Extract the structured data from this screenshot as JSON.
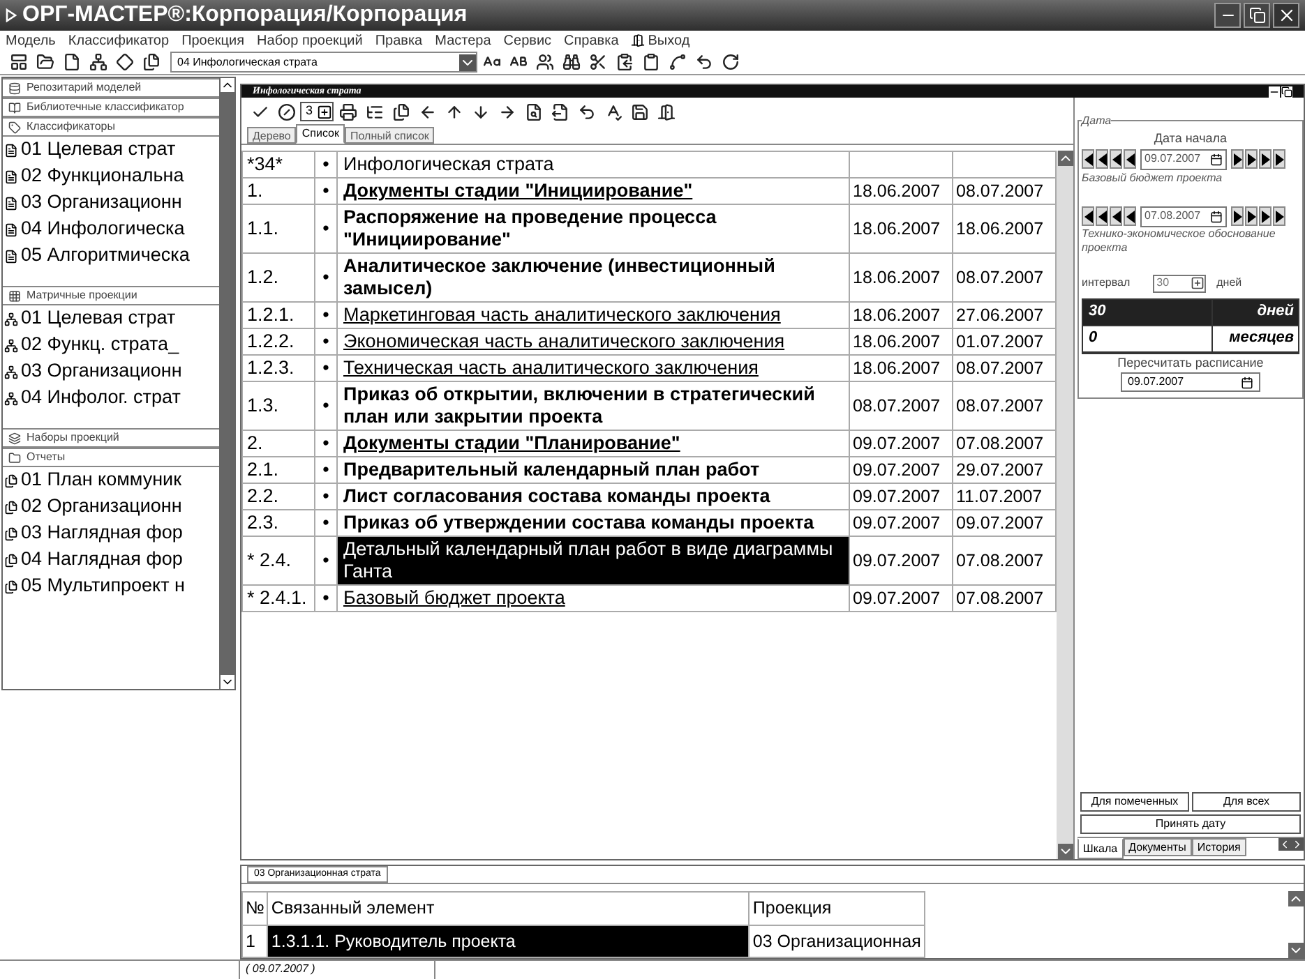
{
  "window": {
    "title": "ОРГ-МАСТЕР®:Корпорация/Корпорация"
  },
  "menu": [
    "Модель",
    "Классификатор",
    "Проекция",
    "Набор проекций",
    "Правка",
    "Мастера",
    "Сервис",
    "Справка",
    "Выход"
  ],
  "toolbar": {
    "projection": "04 Инфологическая страта"
  },
  "left_panel": {
    "sections": [
      {
        "title": "Репозитарий моделей",
        "kind": "repo"
      },
      {
        "title": "Библиотечные классификатор",
        "kind": "library"
      },
      {
        "title": "Классификаторы",
        "kind": "classifier",
        "items": [
          "01 Целевая страт",
          "02 Функциональна",
          "03 Организационн",
          "04 Инфологическа",
          "05 Алгоритмическа"
        ]
      },
      {
        "title": "Матричные проекции",
        "kind": "matrix",
        "items": [
          "01 Целевая страт",
          "02 Функц. страта_",
          "03 Организационн",
          "04 Инфолог. страт"
        ]
      },
      {
        "title": "Наборы проекций",
        "kind": "sets"
      },
      {
        "title": "Отчеты",
        "kind": "reports",
        "items": [
          "01 План коммуник",
          "02 Организационн",
          "03 Наглядная фор",
          "04 Наглядная фор",
          "05 Мультипроект н"
        ]
      }
    ]
  },
  "document": {
    "title": "Инфологическая страта",
    "level_value": "3",
    "tabs": [
      {
        "label": "Дерево",
        "selected": false
      },
      {
        "label": "Список",
        "selected": true
      },
      {
        "label": "Полный список",
        "selected": false
      }
    ],
    "header": {
      "number": "*34*",
      "bullet": "•",
      "name": "Инфологическая страта"
    },
    "rows": [
      {
        "number": "1.",
        "bullet": "•",
        "name": "Документы стадии \"Инициирование\"",
        "kind": "heading",
        "start": "18.06.2007",
        "end": "08.07.2007",
        "selected": false
      },
      {
        "number": "1.1.",
        "bullet": "•",
        "name": "Распоряжение на проведение процесса \"Инициирование\"",
        "kind": "bold",
        "start": "18.06.2007",
        "end": "18.06.2007",
        "selected": false
      },
      {
        "number": "1.2.",
        "bullet": "•",
        "name": "Аналитическое заключение (инвестиционный замысел)",
        "kind": "bold",
        "start": "18.06.2007",
        "end": "08.07.2007",
        "selected": false
      },
      {
        "number": "1.2.1.",
        "bullet": "•",
        "name": "Маркетинговая часть аналитического заключения",
        "kind": "link",
        "start": "18.06.2007",
        "end": "27.06.2007",
        "selected": false
      },
      {
        "number": "1.2.2.",
        "bullet": "•",
        "name": "Экономическая часть аналитического заключения",
        "kind": "link",
        "start": "18.06.2007",
        "end": "01.07.2007",
        "selected": false
      },
      {
        "number": "1.2.3.",
        "bullet": "•",
        "name": "Техническая часть аналитического заключения",
        "kind": "link",
        "start": "18.06.2007",
        "end": "08.07.2007",
        "selected": false
      },
      {
        "number": "1.3.",
        "bullet": "•",
        "name": "Приказ об открытии, включении в стратегический план или закрытии проекта",
        "kind": "bold",
        "start": "08.07.2007",
        "end": "08.07.2007",
        "selected": false
      },
      {
        "number": "2.",
        "bullet": "•",
        "name": "Документы стадии \"Планирование\"",
        "kind": "heading",
        "start": "09.07.2007",
        "end": "07.08.2007",
        "selected": false
      },
      {
        "number": "2.1.",
        "bullet": "•",
        "name": "Предварительный календарный план работ",
        "kind": "bold",
        "start": "09.07.2007",
        "end": "29.07.2007",
        "selected": false
      },
      {
        "number": "2.2.",
        "bullet": "•",
        "name": "Лист согласования состава команды проекта",
        "kind": "bold",
        "start": "09.07.2007",
        "end": "11.07.2007",
        "selected": false
      },
      {
        "number": "2.3.",
        "bullet": "•",
        "name": "Приказ об утверждении состава команды проекта",
        "kind": "bold",
        "start": "09.07.2007",
        "end": "09.07.2007",
        "selected": false
      },
      {
        "number": "* 2.4.",
        "bullet": "•",
        "name": "Детальный календарный план работ в виде диаграммы Ганта",
        "kind": "plain",
        "start": "09.07.2007",
        "end": "07.08.2007",
        "selected": true
      },
      {
        "number": "* 2.4.1.",
        "bullet": "•",
        "name": "Базовый бюджет проекта",
        "kind": "link",
        "start": "09.07.2007",
        "end": "07.08.2007",
        "selected": false
      }
    ]
  },
  "date_panel": {
    "group": "Дата",
    "start_label": "Дата начала",
    "start_date": "09.07.2007",
    "start_caption": "Базовый бюджет проекта",
    "end_date": "07.08.2007",
    "end_caption": "Технико-экономическое обоснование проекта",
    "interval_label": "интервал",
    "interval_value": "30",
    "interval_unit": "дней",
    "units": [
      {
        "value": "30",
        "unit": "дней",
        "selected": true
      },
      {
        "value": "0",
        "unit": "месяцев",
        "selected": false
      }
    ],
    "recalc_label": "Пересчитать расписание",
    "recalc_date": "09.07.2007",
    "buttons": [
      "Для помеченных",
      "Для всех",
      "Принять дату"
    ],
    "tabs": [
      {
        "label": "Шкала",
        "selected": true
      },
      {
        "label": "Документы",
        "selected": false
      },
      {
        "label": "История",
        "selected": false
      }
    ]
  },
  "links_panel": {
    "tab": "03 Организационная страта",
    "columns": [
      "№",
      "Связанный элемент",
      "Проекция"
    ],
    "rows": [
      {
        "cells": [
          "1",
          "1.3.1.1. Руководитель проекта",
          "03 Организационная"
        ],
        "selected": true
      }
    ]
  },
  "status_bar": {
    "date": "( 09.07.2007 )"
  }
}
